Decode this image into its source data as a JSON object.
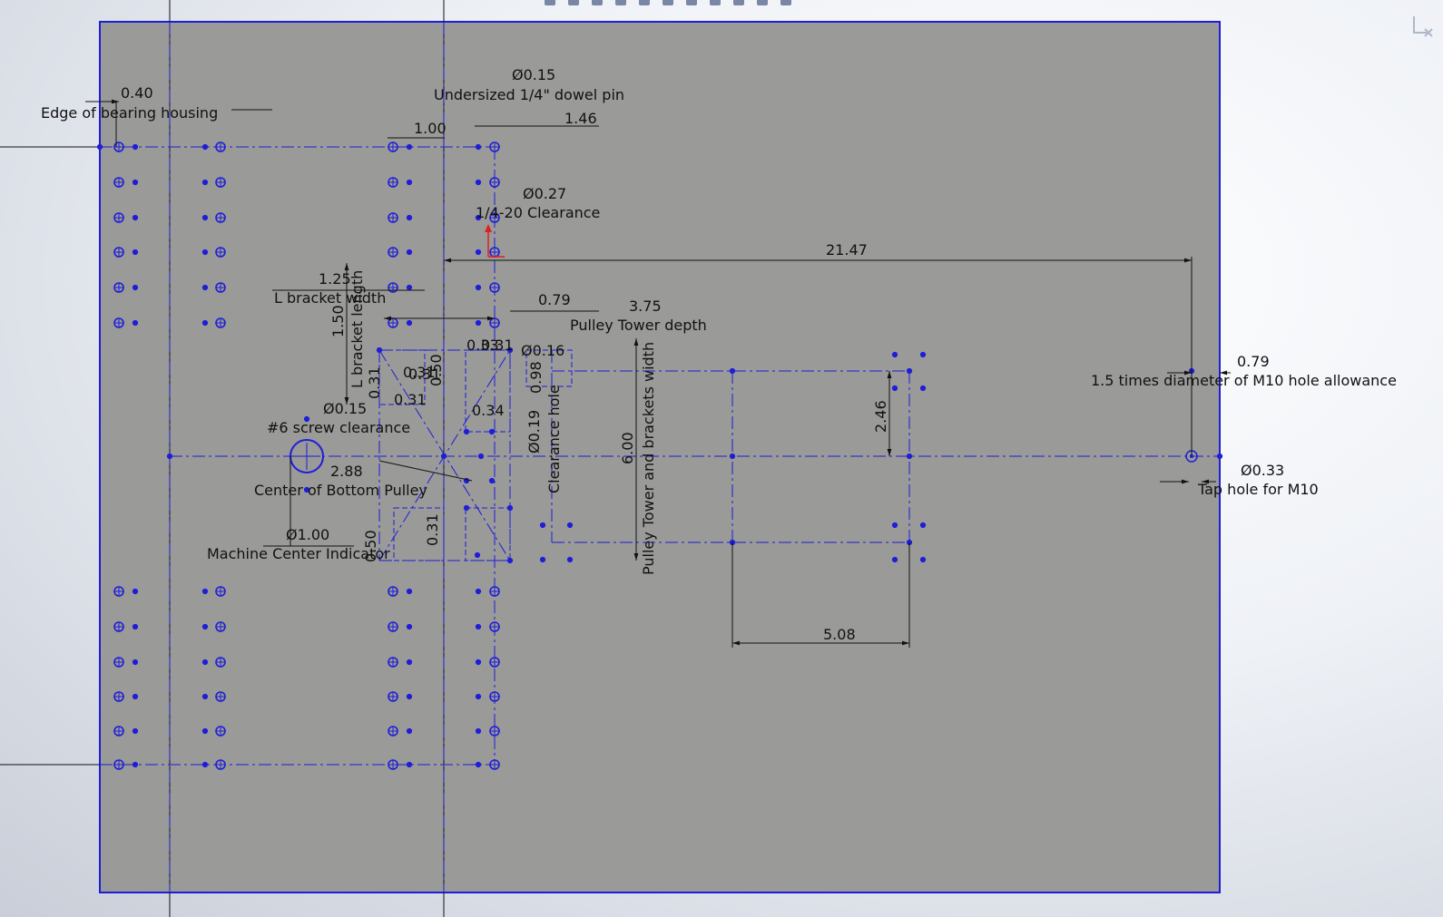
{
  "colors": {
    "sheet": "#9a9a98",
    "sketch": "#1e1ed8",
    "dimension": "#111111",
    "origin_arrow": "#e02020"
  },
  "toolbar": {
    "icons": [
      "dimension-icon",
      "relations-icon",
      "sketch-icon",
      "smart-dimension-icon",
      "text-icon",
      "view-icon",
      "display-icon",
      "hide-show-icon",
      "appearance-icon",
      "scene-icon",
      "more-icon"
    ]
  },
  "icons": {
    "corner_icon": "panel-collapse-icon",
    "origin": "origin-arrow-icon"
  },
  "annotations": {
    "edge_bearing_value": "0.40",
    "edge_bearing_label": "Edge of bearing housing",
    "dowel_diameter": "Ø0.15",
    "dowel_label": "Undersized 1/4\" dowel pin",
    "dim_1_00": "1.00",
    "dim_1_46": "1.46",
    "clearance_diameter": "Ø0.27",
    "clearance_label": "1/4-20 Clearance",
    "dim_21_47": "21.47",
    "bracket_width_value": "1.25",
    "bracket_width_label": "L bracket width",
    "bracket_length_value": "1.50",
    "bracket_length_label": "L bracket length",
    "dim_0_79": "0.79",
    "tower_depth_value": "3.75",
    "tower_depth_label": "Pulley Tower depth",
    "dim_0_31_a": "0.31",
    "dim_0_31_b": "0.31",
    "dim_0_31_c": "0.31",
    "dim_0_31_d": "0.31",
    "dim_0_33": "0.33",
    "dim_0_31_top": "0.31",
    "dim_0_50_a": "0.50",
    "dim_0_16": "Ø0.16",
    "dim_0_98": "0.98",
    "screw_diameter": "Ø0.15",
    "screw_label": "#6 screw clearance",
    "dim_0_34": "0.34",
    "dim_0_19": "Ø0.19",
    "clearance_hole_label": "Clearance hole",
    "dim_6_00": "6.00",
    "tower_width_label": "Pulley Tower and brackets width",
    "dim_2_46": "2.46",
    "m10_allowance_value": "0.79",
    "m10_allowance_label": "1.5 times diameter of M10 hole allowance",
    "pulley_center_value": "2.88",
    "pulley_center_label": "Center of Bottom Pulley",
    "machine_center_diameter": "Ø1.00",
    "machine_center_label": "Machine Center Indicator",
    "dim_0_50_b": "0.50",
    "dim_0_31_e": "0.31",
    "tap_diameter": "Ø0.33",
    "tap_label": "Tap hole for M10",
    "dim_5_08": "5.08"
  }
}
